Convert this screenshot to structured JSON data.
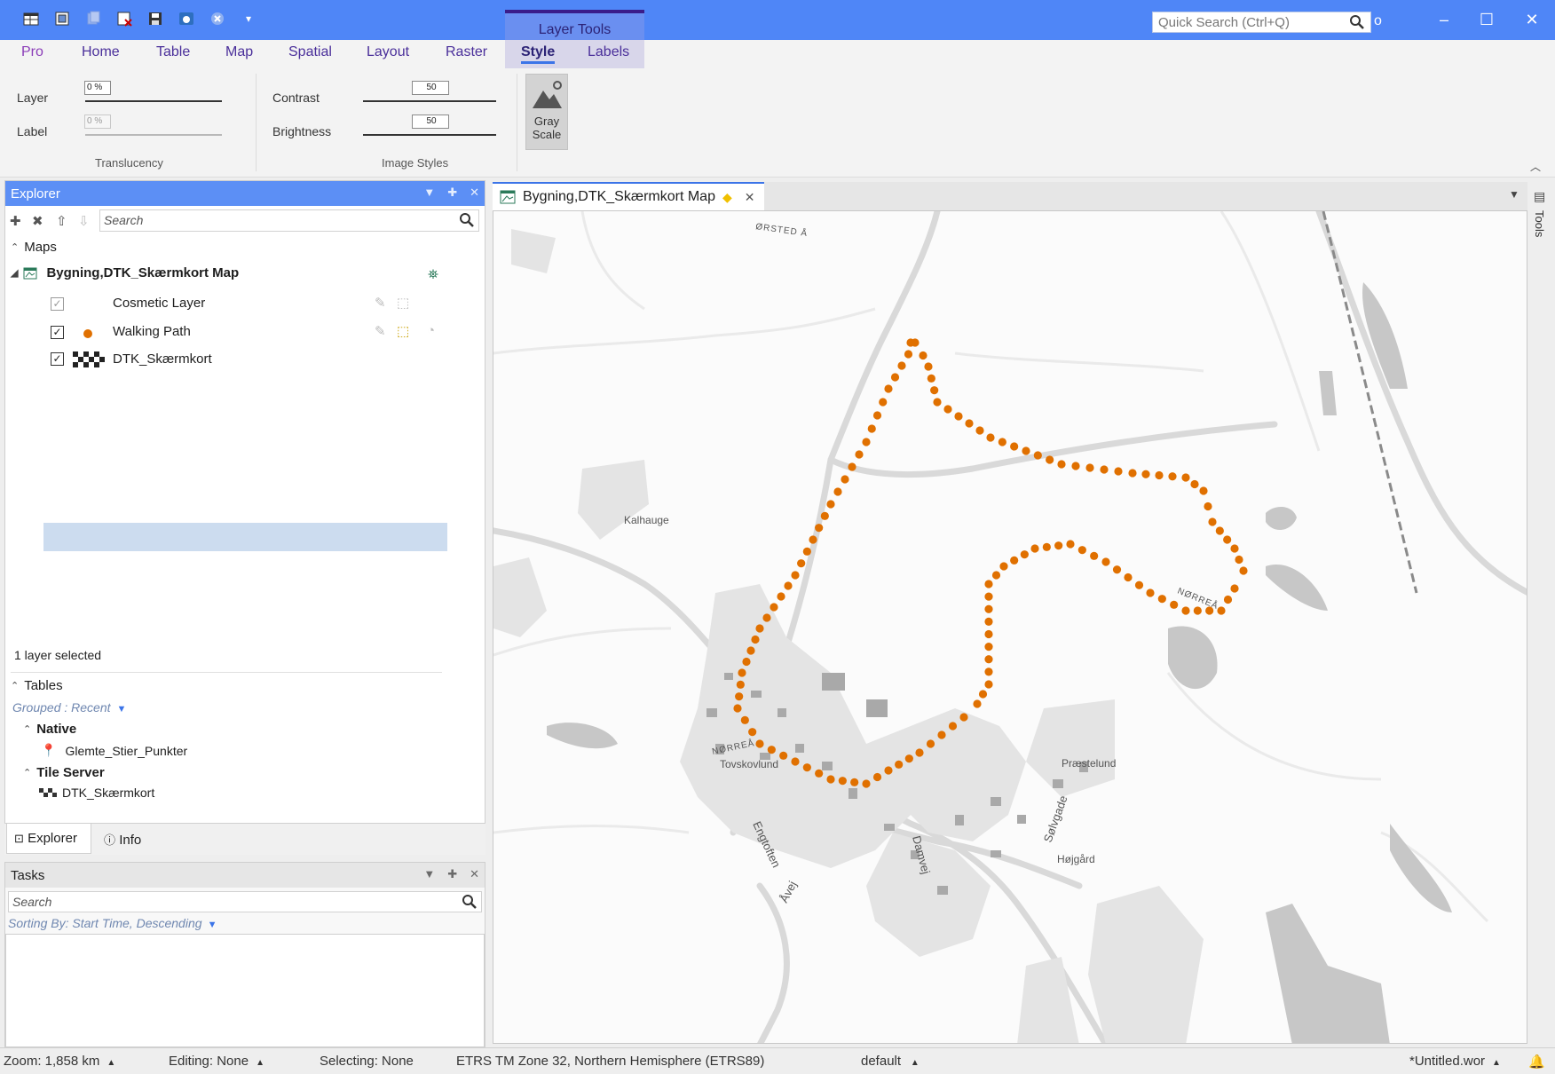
{
  "titlebar": {
    "contextual_tab_group": "Layer Tools",
    "quick_search_placeholder": "Quick Search (Ctrl+Q)",
    "trailing_char": "o"
  },
  "ribbon": {
    "tabs": [
      "Pro",
      "Home",
      "Table",
      "Map",
      "Spatial",
      "Layout",
      "Raster",
      "Style",
      "Labels"
    ],
    "active_tab": "Style",
    "translucency": {
      "layer_label": "Layer",
      "layer_value": "0 %",
      "label_label": "Label",
      "label_value": "0 %",
      "group_label": "Translucency"
    },
    "image_styles": {
      "contrast_label": "Contrast",
      "contrast_value": "50",
      "brightness_label": "Brightness",
      "brightness_value": "50",
      "group_label": "Image Styles"
    },
    "grayscale_button": {
      "line1": "Gray",
      "line2": "Scale"
    }
  },
  "explorer": {
    "title": "Explorer",
    "search_placeholder": "Search",
    "maps_section": "Maps",
    "map_name": "Bygning,DTK_Skærmkort Map",
    "layers": [
      {
        "name": "Cosmetic Layer",
        "checked": true,
        "disabled": true
      },
      {
        "name": "Walking Path",
        "checked": true,
        "disabled": false
      },
      {
        "name": "DTK_Skærmkort",
        "checked": true,
        "disabled": false,
        "selected": true
      }
    ],
    "selection_status": "1 layer selected",
    "tables_section": "Tables",
    "grouped_label": "Grouped : Recent",
    "native_group": "Native",
    "native_item": "Glemte_Stier_Punkter",
    "tile_group": "Tile Server",
    "tile_item": "DTK_Skærmkort",
    "bottom_tabs": [
      "Explorer",
      "Info"
    ]
  },
  "tasks": {
    "title": "Tasks",
    "search_placeholder": "Search",
    "sorting": "Sorting By: Start Time, Descending"
  },
  "map": {
    "tab_title": "Bygning,DTK_Skærmkort Map",
    "labels": {
      "orsted": "ØRSTED Å",
      "kalhauge": "Kalhauge",
      "norrea1": "NØRREÅ",
      "norrea2": "NØRREÅ",
      "tovskovlund": "Tovskovlund",
      "praestelund": "Præstelund",
      "engtoften": "Engtoften",
      "avej": "Åvej",
      "damvej": "Damvej",
      "solvgade": "Sølvgade",
      "hojgard": "Højgård"
    },
    "path_color": "#e07000"
  },
  "tools_side": "Tools",
  "statusbar": {
    "zoom": "Zoom: 1,858 km",
    "editing": "Editing: None",
    "selecting": "Selecting: None",
    "projection": "ETRS TM Zone 32, Northern Hemisphere (ETRS89)",
    "style": "default",
    "workspace": "*Untitled.wor"
  }
}
